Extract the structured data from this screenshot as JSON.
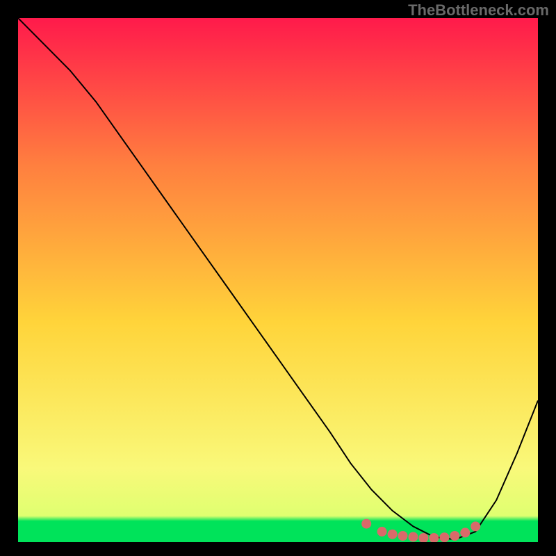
{
  "watermark": "TheBottleneck.com",
  "chart_data": {
    "type": "line",
    "title": "",
    "xlabel": "",
    "ylabel": "",
    "xlim": [
      0,
      100
    ],
    "ylim": [
      0,
      100
    ],
    "grid": false,
    "legend": false,
    "background_gradient": {
      "top": "#ff1a4b",
      "upper_mid": "#ff7f3f",
      "mid": "#ffd43a",
      "lower_mid": "#f9f97a",
      "bottom_band": "#00e35a"
    },
    "series": [
      {
        "name": "bottleneck-curve",
        "color": "#000000",
        "stroke_width": 2,
        "x": [
          0,
          5,
          10,
          15,
          20,
          25,
          30,
          35,
          40,
          45,
          50,
          55,
          60,
          64,
          68,
          72,
          76,
          80,
          84,
          88,
          92,
          96,
          100
        ],
        "y": [
          100,
          95,
          90,
          84,
          77,
          70,
          63,
          56,
          49,
          42,
          35,
          28,
          21,
          15,
          10,
          6,
          3,
          1,
          0.5,
          2,
          8,
          17,
          27
        ]
      }
    ],
    "markers": [
      {
        "name": "optimal-range-dots",
        "color": "#d96a6a",
        "radius": 7,
        "x": [
          67,
          70,
          72,
          74,
          76,
          78,
          80,
          82,
          84,
          86,
          88
        ],
        "y": [
          3.5,
          2.0,
          1.5,
          1.2,
          1.0,
          0.8,
          0.8,
          0.9,
          1.2,
          1.8,
          3.0
        ]
      }
    ]
  }
}
